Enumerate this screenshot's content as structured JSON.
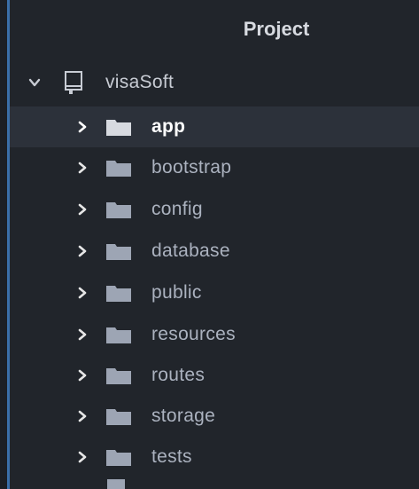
{
  "panel": {
    "title": "Project"
  },
  "root": {
    "label": "visaSoft"
  },
  "items": [
    {
      "label": "app"
    },
    {
      "label": "bootstrap"
    },
    {
      "label": "config"
    },
    {
      "label": "database"
    },
    {
      "label": "public"
    },
    {
      "label": "resources"
    },
    {
      "label": "routes"
    },
    {
      "label": "storage"
    },
    {
      "label": "tests"
    }
  ],
  "colors": {
    "background": "#21252b",
    "selected_row": "#2c313a",
    "accent_edge": "#3b6fa8",
    "folder": "#9da5b4",
    "text": "#abb2bf"
  },
  "icons": {
    "root": "book-icon",
    "folder": "folder-icon",
    "expanded": "chevron-down-icon",
    "collapsed": "chevron-right-icon"
  }
}
